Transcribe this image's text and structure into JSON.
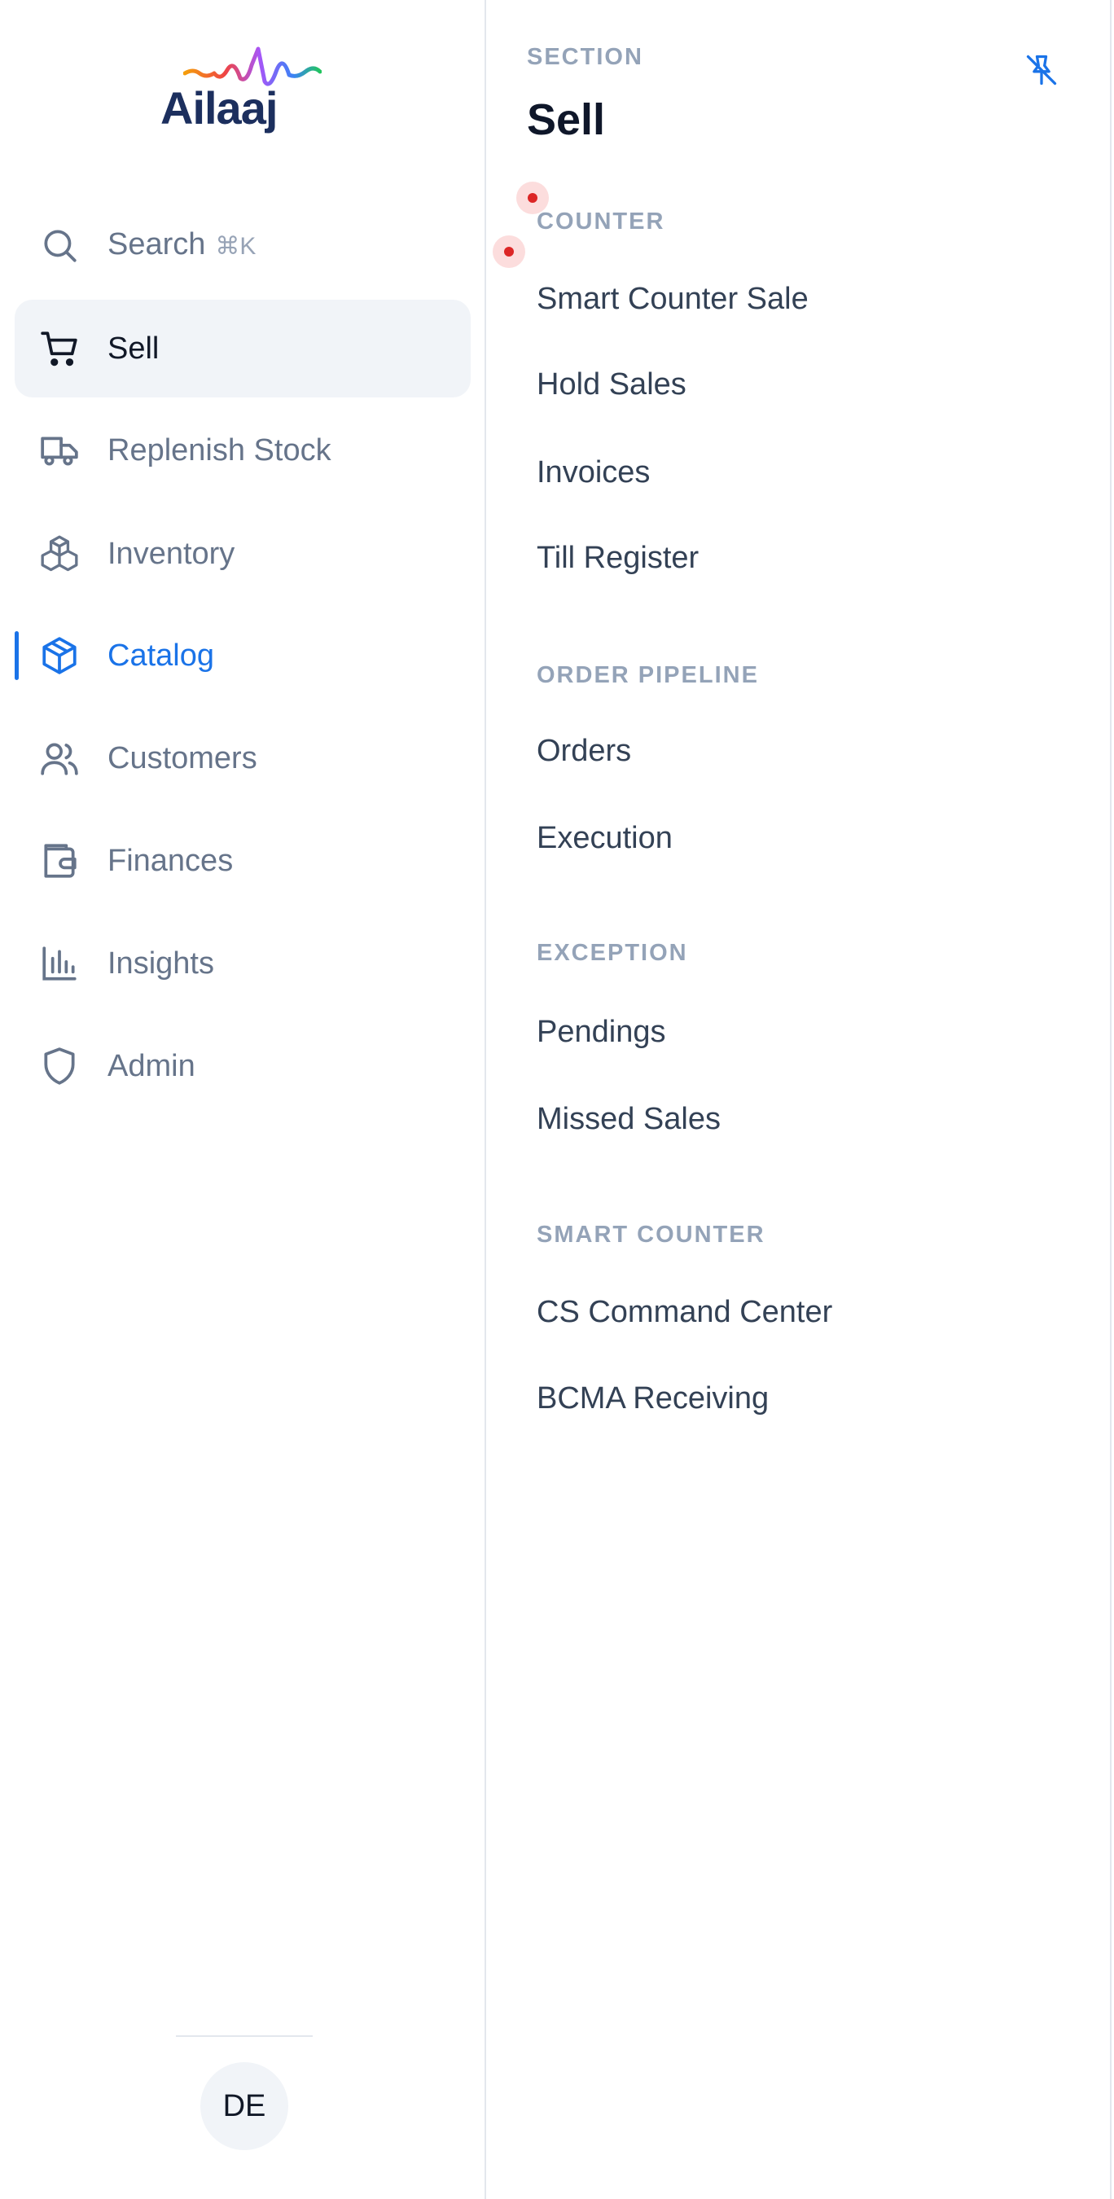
{
  "brand": {
    "name": "Ailaaj"
  },
  "sidebar": {
    "search": {
      "label": "Search",
      "shortcut": "⌘K",
      "icon": "search-icon"
    },
    "items": [
      {
        "label": "Sell",
        "icon": "cart-icon",
        "state": "active"
      },
      {
        "label": "Replenish Stock",
        "icon": "truck-icon",
        "state": "default"
      },
      {
        "label": "Inventory",
        "icon": "boxes-icon",
        "state": "default"
      },
      {
        "label": "Catalog",
        "icon": "package-icon",
        "state": "current"
      },
      {
        "label": "Customers",
        "icon": "users-icon",
        "state": "default"
      },
      {
        "label": "Finances",
        "icon": "wallet-icon",
        "state": "default"
      },
      {
        "label": "Insights",
        "icon": "bar-chart-icon",
        "state": "default"
      },
      {
        "label": "Admin",
        "icon": "shield-icon",
        "state": "default"
      }
    ],
    "user": {
      "initials": "DE"
    }
  },
  "panel": {
    "eyebrow": "SECTION",
    "title": "Sell",
    "pin_icon": "unpin-icon",
    "groups": [
      {
        "label": "COUNTER",
        "links": [
          "Smart Counter Sale",
          "Hold Sales",
          "Invoices",
          "Till Register"
        ]
      },
      {
        "label": "ORDER PIPELINE",
        "links": [
          "Orders",
          "Execution"
        ]
      },
      {
        "label": "EXCEPTION",
        "links": [
          "Pendings",
          "Missed Sales"
        ]
      },
      {
        "label": "SMART COUNTER",
        "links": [
          "CS Command Center",
          "BCMA Receiving"
        ]
      }
    ]
  },
  "colors": {
    "accent": "#1a73e8",
    "text_muted": "#66748a",
    "text_strong": "#111827",
    "group_label": "#94a3b8",
    "active_bg": "#f1f4f8",
    "notification_dot": "#dc2626"
  }
}
